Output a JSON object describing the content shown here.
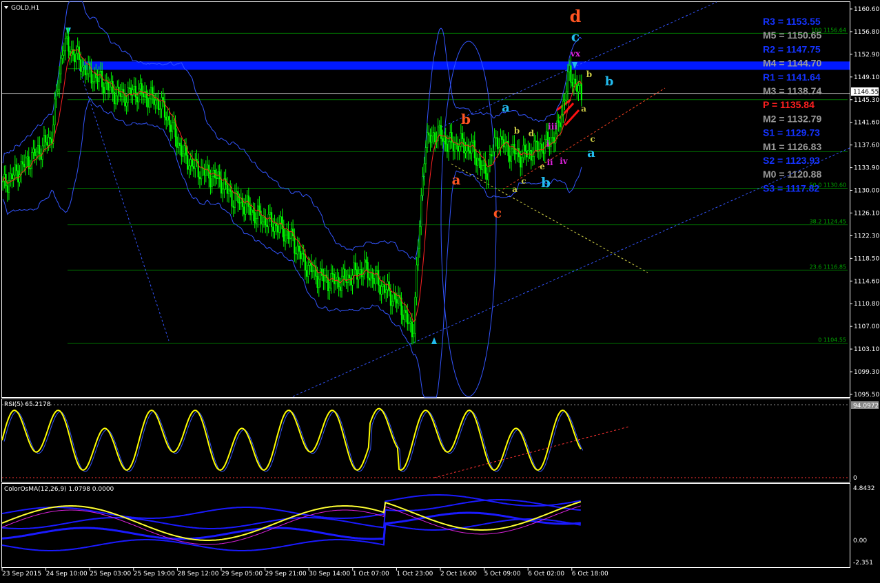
{
  "window": {
    "title": "GOLD,H1"
  },
  "colors": {
    "background": "#000000",
    "candle": "#00ff00",
    "bollinger": "#3355ff",
    "blue_zone": "#0019ff",
    "rsi": "#ffff00",
    "fib_line": "#007700",
    "fib_text": "#00aa00",
    "red_trend": "#ff2222",
    "wave_orange": "#ff5522",
    "wave_cyan": "#22bbee",
    "wave_magenta": "#dd22dd",
    "wave_olive": "#cccc44"
  },
  "indicators": {
    "rsi_label": "RSI(5) 65.2178",
    "rsi_value": "94.0972",
    "rsi_zero": "0",
    "osma_label": "ColorOsMA(12,26,9) 1.0798 0.0000",
    "osma_top": "4.8432",
    "osma_zero": "0.00",
    "osma_bottom": "-2.351"
  },
  "chart_data": {
    "type": "candlestick",
    "symbol": "GOLD",
    "timeframe": "H1",
    "current_price": "1146.55",
    "ylim": [
      1095.5,
      1162.0
    ],
    "price_ticks": [
      "1160.60",
      "1156.80",
      "1152.90",
      "1149.10",
      "1145.30",
      "1141.60",
      "1137.60",
      "1133.90",
      "1130.00",
      "1126.10",
      "1122.30",
      "1118.50",
      "1114.60",
      "1110.80",
      "1107.00",
      "1103.10",
      "1099.30",
      "1095.50"
    ],
    "time_labels": [
      "23 Sep 2015",
      "24 Sep 10:00",
      "25 Sep 03:00",
      "25 Sep 19:00",
      "28 Sep 12:00",
      "29 Sep 05:00",
      "29 Sep 21:00",
      "30 Sep 14:00",
      "1 Oct 07:00",
      "1 Oct 23:00",
      "2 Oct 16:00",
      "5 Oct 09:00",
      "6 Oct 02:00",
      "6 Oct 18:00"
    ],
    "price_path": [
      1131,
      1133,
      1135,
      1137,
      1139,
      1155,
      1153,
      1150,
      1149,
      1147,
      1146,
      1147,
      1146,
      1145,
      1141,
      1136,
      1134,
      1133,
      1132,
      1129,
      1128,
      1126,
      1125,
      1124,
      1122,
      1118,
      1116,
      1115,
      1115,
      1116,
      1117,
      1115,
      1113,
      1111,
      1106,
      1138,
      1140,
      1138,
      1138,
      1137,
      1133,
      1139,
      1137,
      1136,
      1137,
      1138,
      1140,
      1150,
      1146
    ],
    "fib_levels": [
      {
        "label": "100 1156.64",
        "price": 1156.64
      },
      {
        "label": "",
        "price": 1150.7
      },
      {
        "label": "",
        "price": 1145.49
      },
      {
        "label": "",
        "price": 1136.74
      },
      {
        "label": "50.0 1130.60",
        "price": 1130.6
      },
      {
        "label": "38.2 1124.45",
        "price": 1124.45
      },
      {
        "label": "23.6 1116.85",
        "price": 1116.85
      },
      {
        "label": "0 1104.55",
        "price": 1104.55
      }
    ],
    "pivots": [
      {
        "label": "R3 = 1153.55",
        "color": "#1433ff"
      },
      {
        "label": "M5 = 1150.65",
        "color": "#9a9a9a"
      },
      {
        "label": "R2 = 1147.75",
        "color": "#1433ff"
      },
      {
        "label": "M4 = 1144.70",
        "color": "#9a9a9a"
      },
      {
        "label": "R1 = 1141.64",
        "color": "#1433ff"
      },
      {
        "label": "M3 = 1138.74",
        "color": "#9a9a9a"
      },
      {
        "label": "P   = 1135.84",
        "color": "#ff2020"
      },
      {
        "label": "M2 = 1132.79",
        "color": "#9a9a9a"
      },
      {
        "label": "S1 = 1129.73",
        "color": "#1433ff"
      },
      {
        "label": "M1 = 1126.83",
        "color": "#9a9a9a"
      },
      {
        "label": "S2 = 1123.93",
        "color": "#1433ff"
      },
      {
        "label": "M0 = 1120.88",
        "color": "#9a9a9a"
      },
      {
        "label": "S3 = 1117.82",
        "color": "#1433ff"
      }
    ],
    "wave_labels": [
      {
        "text": "d",
        "color": "#ff5522",
        "size": 24
      },
      {
        "text": "c",
        "color": "#22bbee",
        "size": 20
      },
      {
        "text": "vx",
        "color": "#dd22dd",
        "size": 12
      },
      {
        "text": "b",
        "color": "#22bbee",
        "size": 18
      },
      {
        "text": "b",
        "color": "#cccc44",
        "size": 12
      },
      {
        "text": "a",
        "color": "#22bbee",
        "size": 18
      },
      {
        "text": "b",
        "color": "#ff5522",
        "size": 20
      },
      {
        "text": "b",
        "color": "#cccc44",
        "size": 12
      },
      {
        "text": "d",
        "color": "#cccc44",
        "size": 12
      },
      {
        "text": "iii",
        "color": "#dd22dd",
        "size": 12
      },
      {
        "text": "a",
        "color": "#cccc44",
        "size": 12
      },
      {
        "text": "i",
        "color": "#dd22dd",
        "size": 12
      },
      {
        "text": "c",
        "color": "#cccc44",
        "size": 12
      },
      {
        "text": "a",
        "color": "#22bbee",
        "size": 18
      },
      {
        "text": "ii",
        "color": "#dd22dd",
        "size": 12
      },
      {
        "text": "e",
        "color": "#cccc44",
        "size": 12
      },
      {
        "text": "iv",
        "color": "#dd22dd",
        "size": 12
      },
      {
        "text": "c",
        "color": "#cccc44",
        "size": 12
      },
      {
        "text": "a",
        "color": "#cccc44",
        "size": 12
      },
      {
        "text": "b",
        "color": "#22bbee",
        "size": 20
      },
      {
        "text": "a",
        "color": "#ff5522",
        "size": 20
      },
      {
        "text": "c",
        "color": "#ff5522",
        "size": 20
      }
    ]
  }
}
